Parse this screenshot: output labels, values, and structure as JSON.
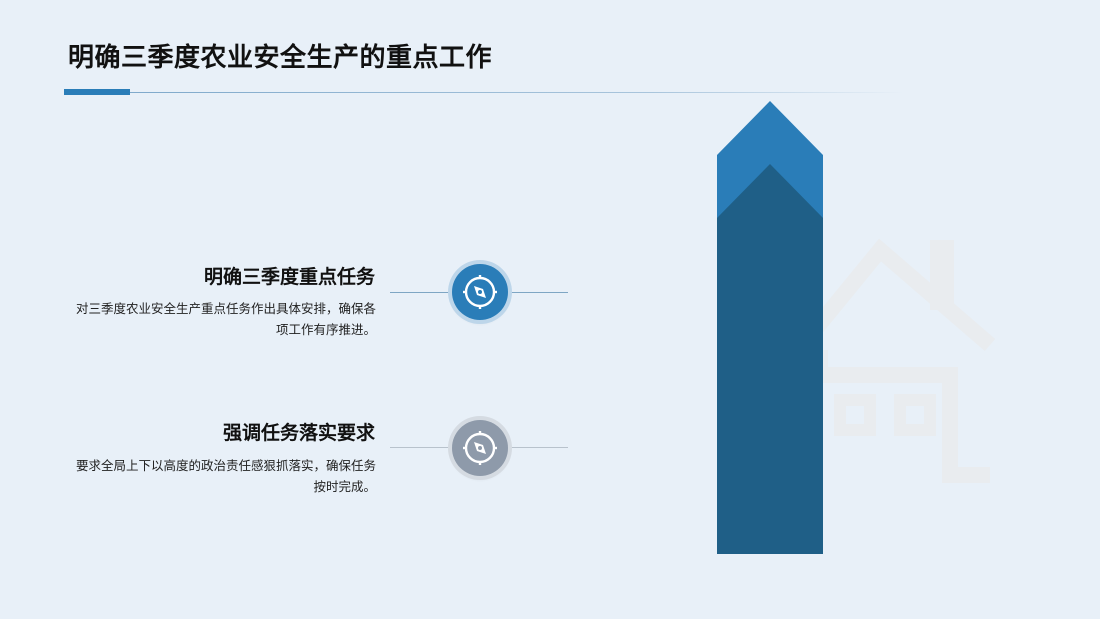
{
  "slide": {
    "title": "明确三季度农业安全生产的重点工作"
  },
  "items": [
    {
      "heading": "明确三季度重点任务",
      "description": "对三季度农业安全生产重点任务作出具体安排，确保各项工作有序推进。",
      "icon": "compass-icon",
      "accent": "#2a7db8"
    },
    {
      "heading": "强调任务落实要求",
      "description": "要求全局上下以高度的政治责任感狠抓落实，确保任务按时完成。",
      "icon": "compass-icon",
      "accent": "#8e9aaa"
    }
  ],
  "decor": {
    "arrow_color_light": "#2a7db8",
    "arrow_color_dark": "#1f5f87",
    "house_icon": "house-icon"
  }
}
